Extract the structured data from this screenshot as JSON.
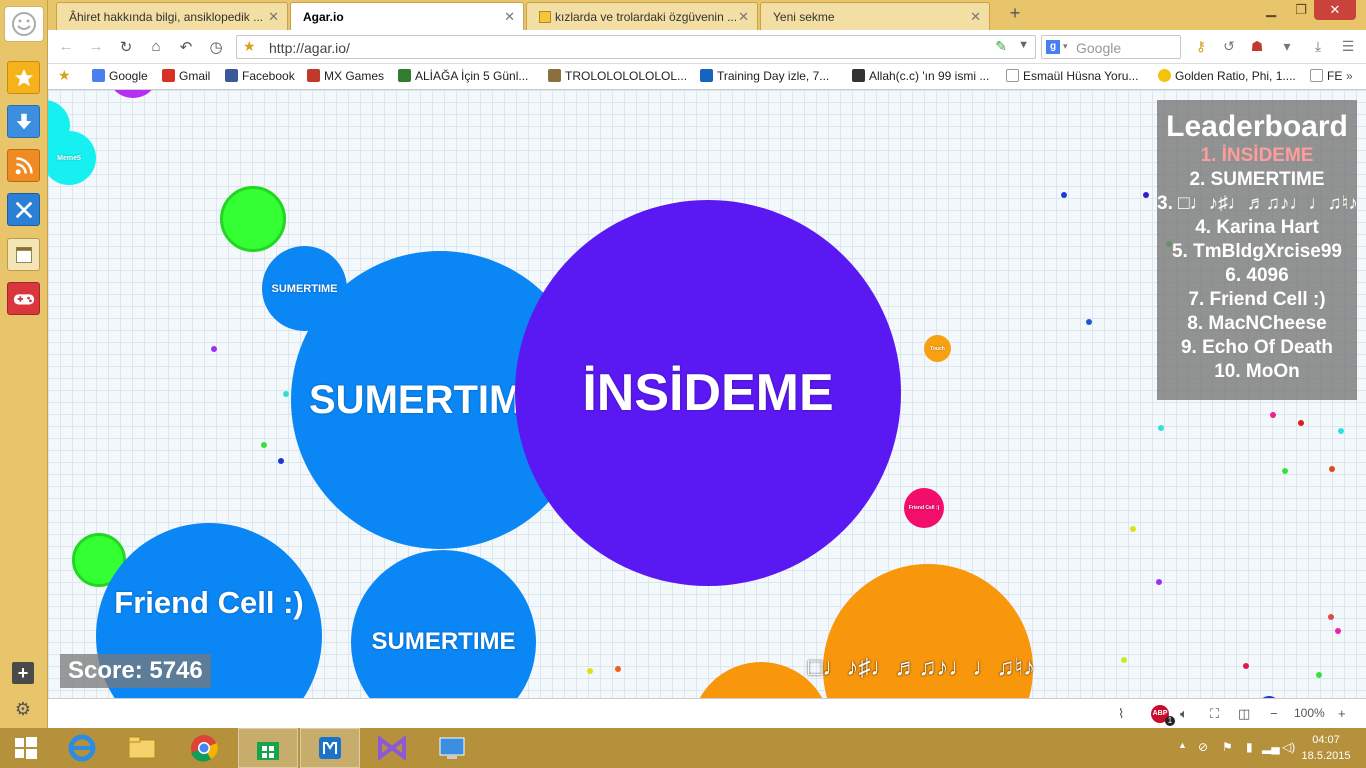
{
  "tabs": [
    {
      "label": "Âhiret hakkında bilgi, ansiklopedik ...",
      "active": false
    },
    {
      "label": "Agar.io",
      "active": true
    },
    {
      "label": "kızlarda ve trolardaki özgüvenin ...",
      "active": false
    },
    {
      "label": "Yeni sekme",
      "active": false
    }
  ],
  "nav": {
    "url": "http://agar.io/",
    "search_placeholder": "Google"
  },
  "bookmarks": [
    {
      "label": "Google",
      "color": "#4a7ff0"
    },
    {
      "label": "Gmail",
      "color": "#d93025"
    },
    {
      "label": "Facebook",
      "color": "#3b5998"
    },
    {
      "label": "MX Games",
      "color": "#c0392b"
    },
    {
      "label": "ALİAĞA İçin 5 Günl...",
      "color": "#2e7d32"
    },
    {
      "label": "TROLOLOLOLOLOL...",
      "color": "#8d6e3f"
    },
    {
      "label": "Training Day izle, 7...",
      "color": "#1565c0"
    },
    {
      "label": "Allah(c.c) 'ın 99 ismi ...",
      "color": "#333333"
    },
    {
      "label": "Esmaül Hüsna Yoru...",
      "color": "#999999"
    },
    {
      "label": "Golden Ratio, Phi, 1....",
      "color": "#f4c20d"
    },
    {
      "label": "FE",
      "color": "#999999"
    }
  ],
  "game": {
    "cells": {
      "insideme": {
        "name": "İNSİDEME",
        "color": "#5a18f2"
      },
      "sumertime_big": {
        "name": "SUMERTIME",
        "color": "#0a86f5"
      },
      "sumertime_small": {
        "name": "SUMERTIME",
        "color": "#0a86f5"
      },
      "sumertime_mid": {
        "name": "SUMERTIME",
        "color": "#0a86f5"
      },
      "friend_cell": {
        "name": "Friend Cell :)",
        "color": "#0a86f5"
      },
      "music_cell": {
        "name": "□♩♪♯♩♬♫♪♩♩♫♮♪",
        "color": "#f8960c"
      },
      "meme_cell": {
        "name": "Meme5",
        "color": "#17f0f0"
      },
      "pink_cell": {
        "name": "Friend Cell :)",
        "color": "#f20e6a"
      },
      "orange_small": {
        "name": "Touch",
        "color": "#f8a012"
      }
    }
  },
  "leaderboard": {
    "title": "Leaderboard",
    "entries": [
      "1. İNSİDEME",
      "2. SUMERTIME",
      "3. □♩♪♯♩♬♫♪♩♩♫♮♪",
      "4. Karina Hart",
      "5. TmBldgXrcise99",
      "6. 4096",
      "7. Friend Cell :)",
      "8. MacNCheese",
      "9. Echo Of Death",
      "10. MoOn"
    ]
  },
  "score": "Score: 5746",
  "status": {
    "zoom": "100%",
    "abp_count": "1"
  },
  "clock": {
    "time": "04:07",
    "date": "18.5.2015"
  }
}
